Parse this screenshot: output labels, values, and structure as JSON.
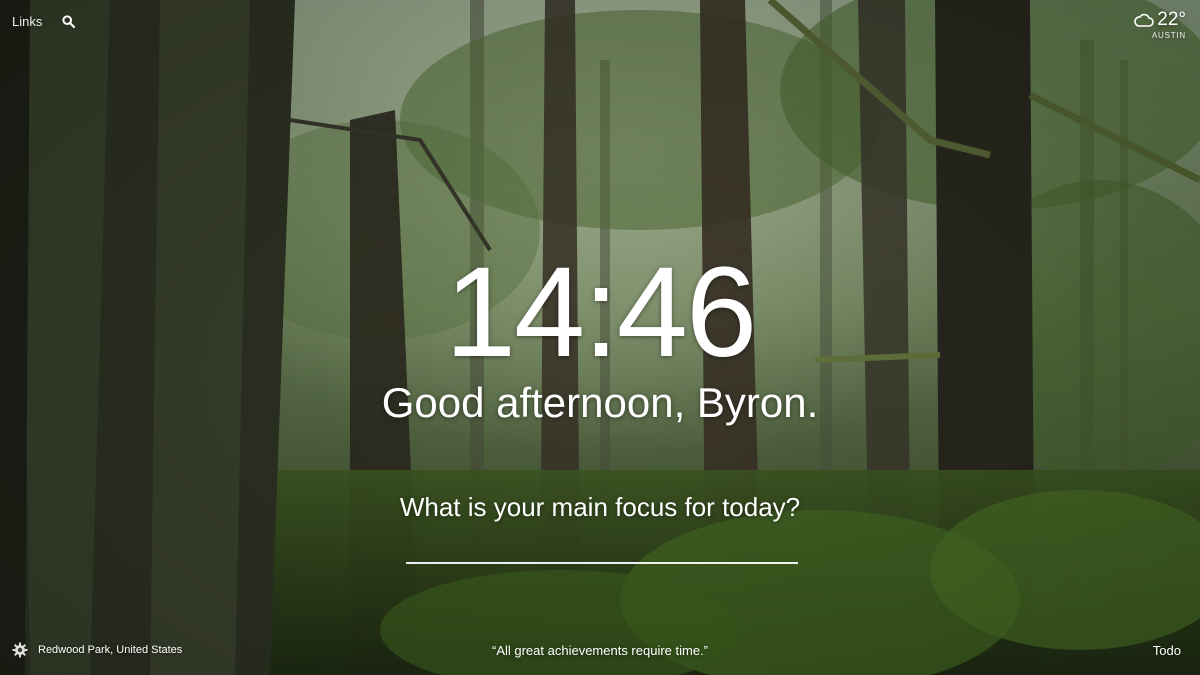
{
  "nav": {
    "links_label": "Links",
    "search_icon": "search-icon"
  },
  "weather": {
    "icon": "cloud-icon",
    "temperature": "22°",
    "location": "AUSTIN"
  },
  "clock": {
    "time": "14:46"
  },
  "greeting": {
    "text": "Good afternoon, Byron."
  },
  "focus": {
    "question": "What is your main focus for today?",
    "value": ""
  },
  "footer": {
    "settings_icon": "gear-icon",
    "photo_location": "Redwood Park, United States",
    "quote": "“All great achievements require time.”",
    "todo_label": "Todo"
  }
}
